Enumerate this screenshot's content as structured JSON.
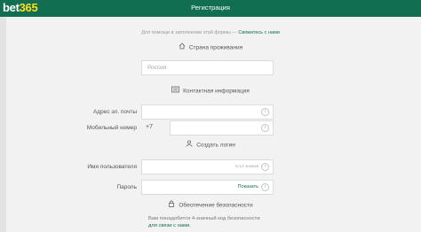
{
  "header": {
    "logo_part1": "bet",
    "logo_part2": "365",
    "title": "Регистрация"
  },
  "help": {
    "text": "Для помощи в заполнении этой формы —",
    "link": "Свяжитесь с нами"
  },
  "sections": {
    "residence": "Страна проживания",
    "contact": "Контактная информация",
    "login": "Создать логин",
    "security": "Обеспечение безопасности"
  },
  "fields": {
    "country_placeholder": "Россия",
    "email_label": "Адрес эл. почты",
    "phone_label": "Мобильный номер",
    "phone_prefix": "+7",
    "username_label": "Имя пользователя",
    "username_hint": "6-14 знаков",
    "password_label": "Пароль",
    "password_show": "Показать"
  },
  "security_note": {
    "line1": "Вам понадобится 4-значный код безопасности",
    "line2": "для связи с нами."
  },
  "colors": {
    "brand_green": "#126e51",
    "logo_yellow": "#ffdf1b",
    "background": "#f2f2f2"
  },
  "icons": [
    "home-icon",
    "contact-card-icon",
    "user-icon",
    "lock-icon",
    "info-icon"
  ]
}
